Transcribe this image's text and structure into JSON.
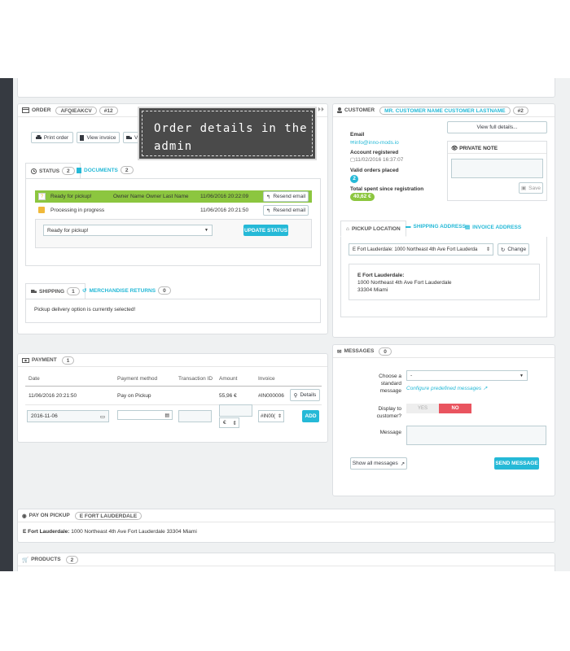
{
  "tooltip": "Order details in the admin",
  "order": {
    "title": "ORDER",
    "reference": "AFQIEAKCV",
    "id": "#12",
    "print_order": "Print order",
    "view_invoice": "View invoice",
    "view_truncated": "Vi",
    "status_tab": "STATUS",
    "status_count": "2",
    "documents_tab": "DOCUMENTS",
    "documents_count": "2",
    "history": [
      {
        "label": "Ready for pickup!",
        "employee": "Owner Name Owner Last Name",
        "date": "11/06/2016 20:22:09",
        "action": "Resend email"
      },
      {
        "label": "Processing in progress",
        "employee": "",
        "date": "11/06/2016 20:21:50",
        "action": "Resend email"
      }
    ],
    "status_select": "Ready for pickup!",
    "update_status": "UPDATE STATUS",
    "shipping_tab": "SHIPPING",
    "shipping_count": "1",
    "returns_tab": "MERCHANDISE RETURNS",
    "returns_count": "0",
    "shipping_note": "Pickup delivery option is currently selected!"
  },
  "payment": {
    "title": "PAYMENT",
    "count": "1",
    "columns": [
      "Date",
      "Payment method",
      "Transaction ID",
      "Amount",
      "Invoice"
    ],
    "row": {
      "date": "11/06/2016 20:21:50",
      "method": "Pay on Pickup",
      "transaction": "",
      "amount": "55,96 €",
      "invoice": "#IN000006",
      "details": "Details"
    },
    "form": {
      "date": "2016-11-06",
      "currency": "€",
      "invoice": "#IN00(",
      "add": "ADD"
    }
  },
  "customer": {
    "title": "CUSTOMER",
    "name": "MR. CUSTOMER NAME CUSTOMER LASTNAME",
    "id": "#2",
    "email_label": "Email",
    "email": "info@inno-mods.io",
    "registered_label": "Account registered",
    "registered": "11/02/2016 16:37:07",
    "valid_orders_label": "Valid orders placed",
    "valid_orders": "2",
    "total_spent_label": "Total spent since registration",
    "total_spent": "40,62 €",
    "view_full": "View full details...",
    "private_note": "PRIVATE NOTE",
    "save": "Save",
    "tabs": [
      "PICKUP LOCATION",
      "SHIPPING ADDRESS",
      "INVOICE ADDRESS"
    ],
    "location_select": "E Fort Lauderdale: 1000 Northeast 4th Ave Fort Lauderda",
    "change": "Change",
    "address": {
      "name": "E Fort Lauderdale:",
      "line1": "1000 Northeast 4th Ave Fort Lauderdale",
      "line2": "33304 Miami"
    }
  },
  "messages": {
    "title": "MESSAGES",
    "count": "0",
    "choose_label_1": "Choose a",
    "choose_label_2": "standard",
    "choose_label_3": "message",
    "choose_value": "-",
    "configure": "Configure predefined messages",
    "display_label_1": "Display to",
    "display_label_2": "customer?",
    "yes": "YES",
    "no": "NO",
    "message_label": "Message",
    "show_all": "Show all messages",
    "send": "SEND MESSAGE"
  },
  "pickup": {
    "title": "PAY ON PICKUP",
    "store": "E FORT LAUDERDALE",
    "store_name": "E Fort Lauderdale:",
    "store_address": "1000 Northeast 4th Ave Fort Lauderdale 33304 Miami"
  },
  "products": {
    "title": "PRODUCTS",
    "count": "2"
  },
  "colors": {
    "accent": "#25b9d7",
    "status_green": "#8cc63f",
    "sidebar": "#363a41",
    "danger": "#e9545f"
  }
}
